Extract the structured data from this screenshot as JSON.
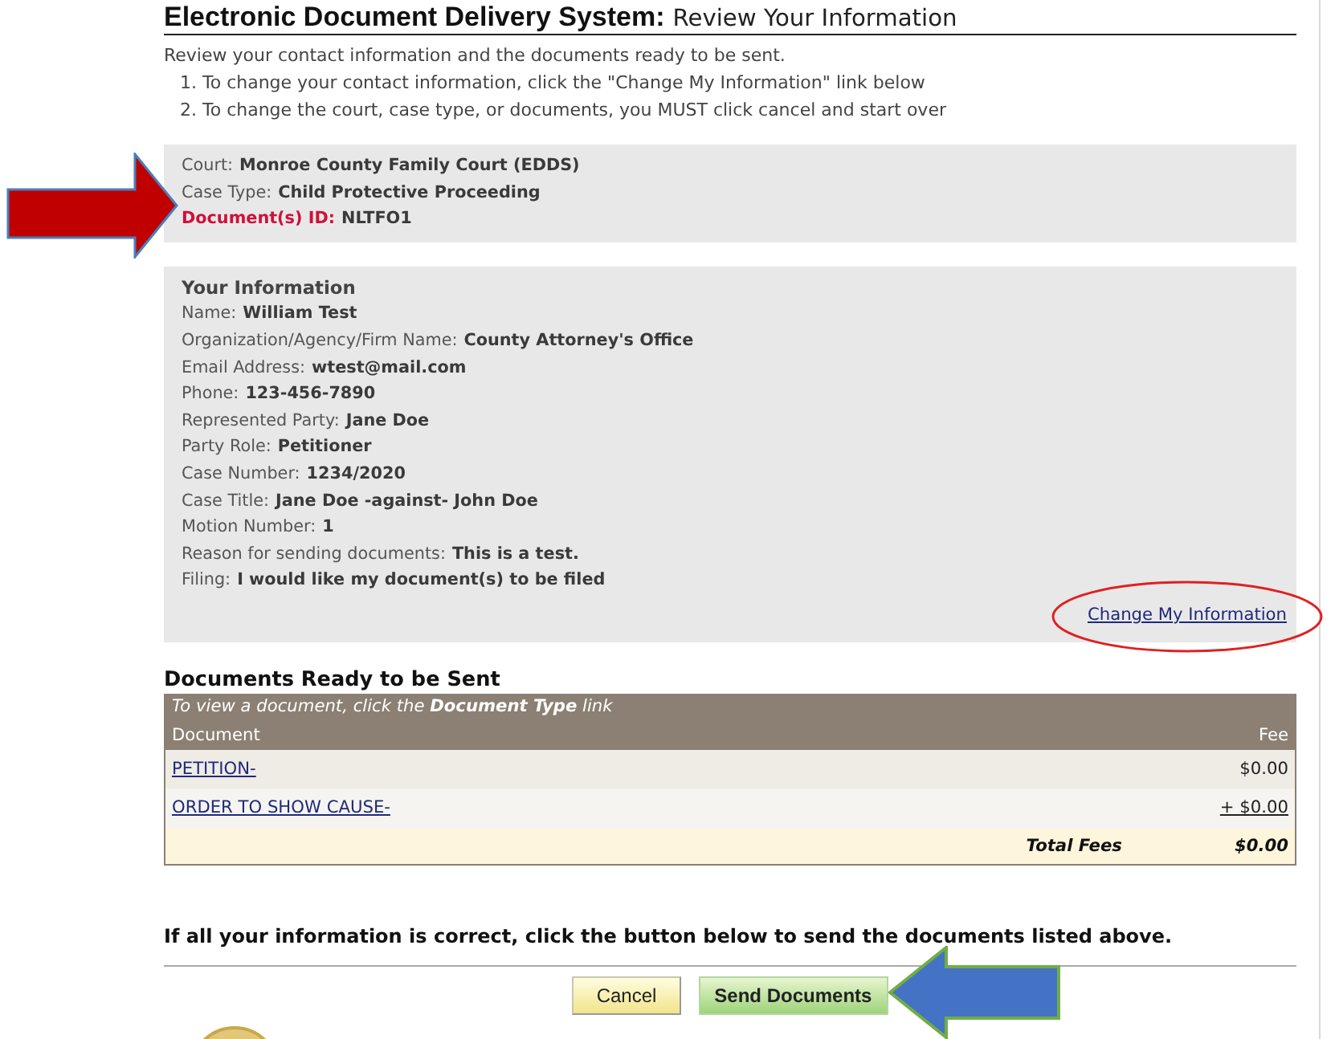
{
  "header": {
    "title": "Electronic Document Delivery System:",
    "subtitle": "Review Your Information"
  },
  "intro": {
    "text": "Review your contact information and the documents ready to be sent.",
    "steps": [
      "1. To change your contact information, click the \"Change My Information\" link below",
      "2. To change the court, case type, or documents, you MUST click cancel and start over"
    ]
  },
  "case_summary": {
    "fields": [
      {
        "label": "Court:",
        "value": "Monroe County Family Court (EDDS)",
        "highlighted": false
      },
      {
        "label": "Case Type:",
        "value": "Child Protective Proceeding",
        "highlighted": false
      },
      {
        "label": "Document(s) ID:",
        "value": "NLTFO1",
        "highlighted": true
      }
    ]
  },
  "your_information": {
    "title": "Your Information",
    "fields": [
      {
        "label": "Name:",
        "value": "William Test"
      },
      {
        "label": "Organization/Agency/Firm Name:",
        "value": "County Attorney's Office"
      },
      {
        "label": "Email Address:",
        "value": "wtest@mail.com"
      },
      {
        "label": "Phone:",
        "value": "123-456-7890"
      },
      {
        "label": "Represented Party:",
        "value": "Jane Doe"
      },
      {
        "label": "Party Role:",
        "value": "Petitioner"
      },
      {
        "label": "Case Number:",
        "value": "1234/2020"
      },
      {
        "label": "Case Title:",
        "value": "Jane Doe -against- John Doe"
      },
      {
        "label": "Motion Number:",
        "value": "1"
      },
      {
        "label": "Reason for sending documents:",
        "value": "This is a test."
      },
      {
        "label": "Filing:",
        "value": "I would like my document(s) to be filed"
      }
    ],
    "change_link": "Change My Information"
  },
  "documents": {
    "title": "Documents Ready to be Sent",
    "hint": "To view a document, click the **Document Type** link",
    "columns": [
      "Document",
      "Fee"
    ],
    "rows": [
      {
        "document": "PETITION-",
        "fee": "$0.00"
      },
      {
        "document": "ORDER TO SHOW CAUSE-",
        "fee": "+ $0.00"
      }
    ],
    "total": {
      "label": "Total Fees",
      "value": "$0.00"
    }
  },
  "confirmation": "If all your information is correct, click the button below to send the documents listed above.",
  "buttons": [
    {
      "label": "Cancel",
      "kind": "secondary"
    },
    {
      "label": "Send Documents",
      "kind": "primary"
    }
  ]
}
